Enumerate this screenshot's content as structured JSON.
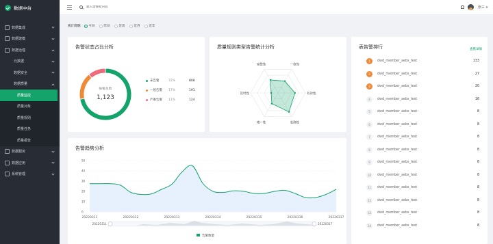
{
  "app": {
    "title": "数据中台"
  },
  "sidebar": {
    "items": [
      {
        "label": "数据集成",
        "level": 0,
        "icon": "integration-icon",
        "expanded": false
      },
      {
        "label": "数据建模",
        "level": 0,
        "icon": "modeling-icon",
        "expanded": false
      },
      {
        "label": "数据治理",
        "level": 0,
        "icon": "governance-icon",
        "expanded": true
      },
      {
        "label": "元数据",
        "level": 1,
        "expanded": false
      },
      {
        "label": "数据安全",
        "level": 1,
        "expanded": false
      },
      {
        "label": "数据质量",
        "level": 1,
        "expanded": true
      },
      {
        "label": "质量监控",
        "level": 2,
        "active": true
      },
      {
        "label": "质量对象",
        "level": 2
      },
      {
        "label": "质量规则",
        "level": 2
      },
      {
        "label": "质量任务",
        "level": 2
      },
      {
        "label": "质量报告",
        "level": 2
      },
      {
        "label": "数据服务",
        "level": 0,
        "icon": "service-icon",
        "expanded": false
      },
      {
        "label": "数据应用",
        "level": 0,
        "icon": "application-icon",
        "expanded": false
      },
      {
        "label": "系统管理",
        "level": 0,
        "icon": "settings-icon",
        "expanded": false
      }
    ]
  },
  "topbar": {
    "search_placeholder": "输入需搜索内容",
    "username": "张三"
  },
  "period": {
    "label": "统计周期:",
    "options": [
      "今日",
      "昨日",
      "近周",
      "近月",
      "近年"
    ],
    "selected": "今日"
  },
  "status_card": {
    "title": "告警状态占比分析",
    "center_label": "报警总数",
    "center_value": "1,123",
    "legend": [
      {
        "name": "未告警",
        "pct": "72%",
        "count": "808",
        "color": "#13a36b"
      },
      {
        "name": "一般告警",
        "pct": "17%",
        "count": "191",
        "color": "#f08a36"
      },
      {
        "name": "严重告警",
        "pct": "11%",
        "count": "124",
        "color": "#ee6b7e"
      }
    ]
  },
  "radar_card": {
    "title": "质量规则类型告警统计分析",
    "indicators": [
      "完整性",
      "一致性",
      "有效性",
      "准确性",
      "唯一性",
      "及时性"
    ],
    "values": [
      0.55,
      0.5,
      0.62,
      0.8,
      0.45,
      0.25
    ]
  },
  "trend_card": {
    "title": "告警趋势分析",
    "legend_label": "告警数量",
    "zoom_start_label": "20220311",
    "zoom_end_label": "20220317"
  },
  "rank_card": {
    "title": "表告警排行",
    "more_label": "查看详情",
    "rows": [
      {
        "rank": "1",
        "name": "dwd_member_aebs_test",
        "value": "133"
      },
      {
        "rank": "2",
        "name": "dwd_member_aebs_test",
        "value": "27"
      },
      {
        "rank": "3",
        "name": "dwd_member_aebs_test",
        "value": "20"
      },
      {
        "rank": "4",
        "name": "dwd_member_aebs_test",
        "value": "16"
      },
      {
        "rank": "5",
        "name": "dwd_member_aebs_test",
        "value": "8"
      },
      {
        "rank": "6",
        "name": "dwd_member_aebs_test",
        "value": "8"
      },
      {
        "rank": "7",
        "name": "dwd_member_aebs_test",
        "value": "8"
      },
      {
        "rank": "8",
        "name": "dwd_member_aebs_test",
        "value": "8"
      },
      {
        "rank": "9",
        "name": "dwd_member_aebs_test",
        "value": "8"
      },
      {
        "rank": "10",
        "name": "dwd_member_aebs_test",
        "value": "8"
      },
      {
        "rank": "11",
        "name": "dwd_member_aebs_test",
        "value": "8"
      },
      {
        "rank": "12",
        "name": "dwd_member_aebs_test",
        "value": "8"
      },
      {
        "rank": "13",
        "name": "dwd_member_aebs_test",
        "value": "8"
      },
      {
        "rank": "14",
        "name": "dwd_member_aebs_test",
        "value": "8"
      }
    ]
  },
  "chart_data": [
    {
      "type": "pie",
      "title": "告警状态占比分析",
      "labels": [
        "未告警",
        "一般告警",
        "严重告警"
      ],
      "values": [
        808,
        191,
        124
      ],
      "percents": [
        72,
        17,
        11
      ],
      "colors": [
        "#13a36b",
        "#f08a36",
        "#ee6b7e"
      ]
    },
    {
      "type": "radar",
      "title": "质量规则类型告警统计分析",
      "indicators": [
        "完整性",
        "一致性",
        "有效性",
        "准确性",
        "唯一性",
        "及时性"
      ],
      "values": [
        0.55,
        0.5,
        0.62,
        0.8,
        0.45,
        0.25
      ],
      "color": "#13a36b"
    },
    {
      "type": "area",
      "title": "告警趋势分析",
      "categories": [
        "20220311",
        "20220312",
        "20220313",
        "20220314",
        "20220315",
        "20220316",
        "20220317"
      ],
      "x": [
        0,
        0.25,
        0.5,
        0.75,
        1,
        1.25,
        1.5,
        1.75,
        2,
        2.25,
        2.5,
        2.75,
        3,
        3.25,
        3.5,
        3.75,
        4,
        4.25,
        4.5,
        4.75,
        5,
        5.25,
        5.5,
        5.75,
        6
      ],
      "series": [
        {
          "name": "告警数量",
          "values": [
            27.5,
            27.5,
            27.5,
            26,
            19,
            17,
            17.5,
            22,
            27,
            39,
            45,
            28,
            20,
            19,
            20.5,
            20,
            18,
            18,
            20,
            21,
            18,
            14,
            14,
            17,
            22
          ]
        }
      ],
      "ylim": [
        0,
        50
      ],
      "yticks": [
        0,
        10,
        20,
        30,
        40,
        50
      ],
      "grid": true,
      "color": "#13a36b"
    }
  ]
}
